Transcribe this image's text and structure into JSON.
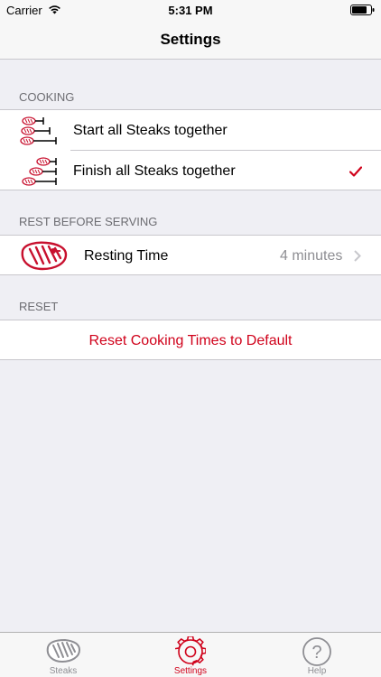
{
  "status_bar": {
    "carrier": "Carrier",
    "time": "5:31 PM"
  },
  "nav": {
    "title": "Settings"
  },
  "cooking": {
    "header": "COOKING",
    "start_label": "Start all Steaks together",
    "finish_label": "Finish all Steaks together",
    "selected": "finish"
  },
  "rest": {
    "header": "REST BEFORE SERVING",
    "resting_label": "Resting Time",
    "resting_value": "4 minutes"
  },
  "reset": {
    "header": "RESET",
    "button_label": "Reset Cooking Times to Default"
  },
  "tabs": [
    {
      "label": "Steaks",
      "icon": "steak-icon",
      "active": false
    },
    {
      "label": "Settings",
      "icon": "gear-icon",
      "active": true
    },
    {
      "label": "Help",
      "icon": "question-icon",
      "active": false
    }
  ],
  "colors": {
    "accent": "#d0021b",
    "inactive": "#8e8e93",
    "background": "#efeff4"
  }
}
